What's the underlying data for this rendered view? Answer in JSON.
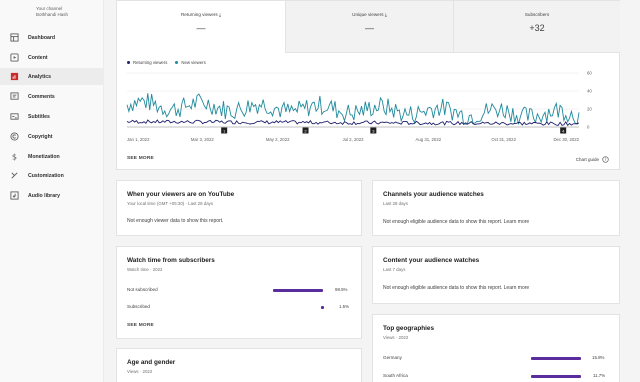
{
  "sidebar": {
    "channel_line1": "Your channel",
    "channel_line2": "Bothhandi Hash",
    "items": [
      {
        "label": "Dashboard",
        "icon": "dashboard-icon"
      },
      {
        "label": "Content",
        "icon": "content-icon"
      },
      {
        "label": "Analytics",
        "icon": "analytics-icon",
        "active": true
      },
      {
        "label": "Comments",
        "icon": "comments-icon"
      },
      {
        "label": "Subtitles",
        "icon": "subtitles-icon"
      },
      {
        "label": "Copyright",
        "icon": "copyright-icon"
      },
      {
        "label": "Monetization",
        "icon": "monetization-icon"
      },
      {
        "label": "Customization",
        "icon": "customization-icon"
      },
      {
        "label": "Audio library",
        "icon": "audio-library-icon"
      }
    ]
  },
  "overview": {
    "tabs": [
      {
        "label": "Returning viewers",
        "value": "—"
      },
      {
        "label": "Unique viewers",
        "value": "—"
      },
      {
        "label": "Subscribers",
        "value": "+32"
      }
    ],
    "see_more": "SEE MORE",
    "chart_guide": "Chart guide"
  },
  "chart_data": {
    "type": "line",
    "series": [
      {
        "name": "Returning viewers",
        "color": "#1d1e6b"
      },
      {
        "name": "New viewers",
        "color": "#1f8a9c"
      }
    ],
    "x_ticks": [
      "Jan 1, 2022",
      "Mar 3, 2022",
      "May 2, 2022",
      "Jul 2, 2022",
      "Aug 31, 2022",
      "Oct 31, 2022",
      "Dec 30, 2022"
    ],
    "y_ticks": [
      "60",
      "40",
      "20",
      "0"
    ],
    "ylim": [
      0,
      60
    ],
    "markers": [
      "1",
      "2",
      "3",
      "4"
    ]
  },
  "when_viewers": {
    "title": "When your viewers are on YouTube",
    "subtitle": "Your local time (GMT +05:30) · Last 28 days",
    "message": "Not enough viewer data to show this report."
  },
  "channels_watch": {
    "title": "Channels your audience watches",
    "subtitle": "Last 28 days",
    "message": "Not enough eligible audience data to show this report. Learn more"
  },
  "watch_time": {
    "title": "Watch time from subscribers",
    "subtitle": "Watch time · 2022",
    "rows": [
      {
        "label": "Not subscribed",
        "pct": "98.5%",
        "fraction": 0.985
      },
      {
        "label": "Subscribed",
        "pct": "1.5%",
        "fraction": 0.015
      }
    ],
    "see_more": "SEE MORE"
  },
  "content_watch": {
    "title": "Content your audience watches",
    "subtitle": "Last 7 days",
    "message": "Not enough eligible audience data to show this report. Learn more"
  },
  "age_gender": {
    "title": "Age and gender",
    "subtitle": "Views · 2022"
  },
  "geographies": {
    "title": "Top geographies",
    "subtitle": "Views · 2022",
    "rows": [
      {
        "label": "Germany",
        "pct": "15.8%",
        "fraction": 1.0
      },
      {
        "label": "South Africa",
        "pct": "11.7%",
        "fraction": 0.74
      }
    ]
  }
}
